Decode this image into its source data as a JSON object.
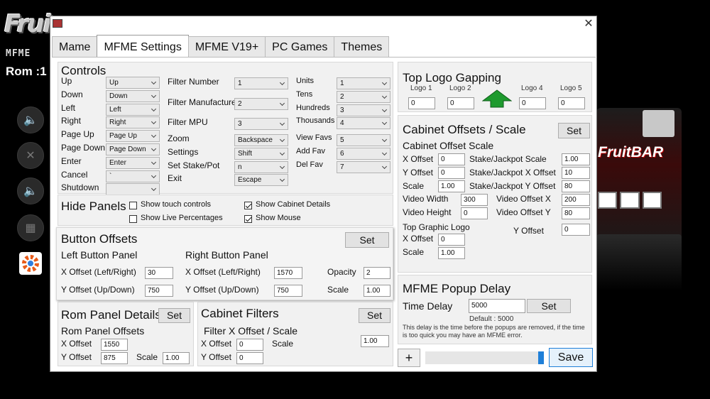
{
  "background": {
    "logo": "Frui",
    "subtitle": "MFME",
    "rom_label": "Rom :1",
    "machine_title": "FruitBAR"
  },
  "window": {
    "close_glyph": "✕",
    "tabs": [
      "Mame",
      "MFME Settings",
      "MFME V19+",
      "PC Games",
      "Themes"
    ],
    "active_tab": "MFME Settings"
  },
  "controls": {
    "title": "Controls",
    "keys": [
      {
        "label": "Up",
        "value": "Up"
      },
      {
        "label": "Down",
        "value": "Down"
      },
      {
        "label": "Left",
        "value": "Left"
      },
      {
        "label": "Right",
        "value": "Right"
      },
      {
        "label": "Page Up",
        "value": "Page Up"
      },
      {
        "label": "Page Down",
        "value": "Page Down"
      },
      {
        "label": "Enter",
        "value": "Enter"
      },
      {
        "label": "Cancel",
        "value": "`"
      },
      {
        "label": "Shutdown",
        "value": ""
      }
    ],
    "filters": [
      {
        "label": "Filter Number",
        "value": "1"
      },
      {
        "label": "Filter Manufacture",
        "value": "2"
      },
      {
        "label": "Filter MPU",
        "value": "3"
      }
    ],
    "misc": [
      {
        "label": "Zoom",
        "value": "Backspace"
      },
      {
        "label": "Settings",
        "value": "Shift"
      },
      {
        "label": "Set Stake/Pot",
        "value": "n"
      },
      {
        "label": "Exit",
        "value": "Escape"
      }
    ],
    "values": [
      {
        "label": "Units",
        "value": "1"
      },
      {
        "label": "Tens",
        "value": "2"
      },
      {
        "label": "Hundreds",
        "value": "3"
      },
      {
        "label": "Thousands",
        "value": "4"
      }
    ],
    "favs": [
      {
        "label": "View Favs",
        "value": "5"
      },
      {
        "label": "Add Fav",
        "value": "6"
      },
      {
        "label": "Del Fav",
        "value": "7"
      }
    ]
  },
  "hide_panels": {
    "title": "Hide Panels",
    "options": [
      {
        "label": "Show touch controls",
        "checked": false
      },
      {
        "label": "Show Live Percentages",
        "checked": false
      },
      {
        "label": "Show Cabinet Details",
        "checked": true
      },
      {
        "label": "Show Mouse",
        "checked": true
      }
    ]
  },
  "button_offsets": {
    "title": "Button Offsets",
    "set_label": "Set",
    "left_title": "Left Button Panel",
    "right_title": "Right Button Panel",
    "left_x_label": "X Offset (Left/Right)",
    "left_x_value": "30",
    "left_y_label": "Y Offset (Up/Down)",
    "left_y_value": "750",
    "right_x_label": "X Offset (Left/Right)",
    "right_x_value": "1570",
    "right_y_label": "Y Offset (Up/Down)",
    "right_y_value": "750",
    "opacity_label": "Opacity",
    "opacity_value": "2",
    "scale_label": "Scale",
    "scale_value": "1.00"
  },
  "rom_panel": {
    "title": "Rom Panel Details",
    "set_label": "Set",
    "sub_title": "Rom Panel Offsets",
    "x_label": "X Offset",
    "x_value": "1550",
    "y_label": "Y Offset",
    "y_value": "875",
    "scale_label": "Scale",
    "scale_value": "1.00"
  },
  "cabinet_filters": {
    "title": "Cabinet Filters",
    "set_label": "Set",
    "sub_title": "Filter X Offset / Scale",
    "x_label": "X Offset",
    "x_value": "0",
    "y_label": "Y Offset",
    "y_value": "0",
    "scale_label": "Scale",
    "scale_value": "1.00"
  },
  "top_logo": {
    "title": "Top Logo Gapping",
    "logos": [
      {
        "label": "Logo 1",
        "value": "0"
      },
      {
        "label": "Logo 2",
        "value": "0"
      },
      {
        "label": "Logo 4",
        "value": "0"
      },
      {
        "label": "Logo 5",
        "value": "0"
      }
    ],
    "arrow_color": "#1e9a2e"
  },
  "cabinet_offsets": {
    "title": "Cabinet Offsets / Scale",
    "set_label": "Set",
    "sub_title": "Cabinet Offset  Scale",
    "x_label": "X Offset",
    "x_value": "0",
    "y_label": "Y Offset",
    "y_value": "0",
    "scale_label": "Scale",
    "scale_value": "1.00",
    "stake_scale_label": "Stake/Jackpot Scale",
    "stake_scale_value": "1.00",
    "stake_x_label": "Stake/Jackpot X Offset",
    "stake_x_value": "10",
    "stake_y_label": "Stake/Jackpot Y Offset",
    "stake_y_value": "80",
    "video_width_label": "Video Width",
    "video_width_value": "300",
    "video_height_label": "Video Height",
    "video_height_value": "0",
    "video_x_label": "Video Offset X",
    "video_x_value": "200",
    "video_y_label": "Video Offset Y",
    "video_y_value": "80",
    "graphic_title": "Top Graphic Logo",
    "graphic_x_label": "X Offset",
    "graphic_x_value": "0",
    "graphic_y_label": "Y Offset",
    "graphic_y_value": "0",
    "graphic_scale_label": "Scale",
    "graphic_scale_value": "1.00"
  },
  "popup_delay": {
    "title": "MFME Popup Delay",
    "time_label": "Time Delay",
    "time_value": "5000",
    "set_label": "Set",
    "default_text": "Default : 5000",
    "description": "This delay is the time before the popups are removed, if the time is too quick you may have an MFME error."
  },
  "footer": {
    "add_label": "+",
    "save_label": "Save",
    "accent_color": "#1e7fd8"
  }
}
